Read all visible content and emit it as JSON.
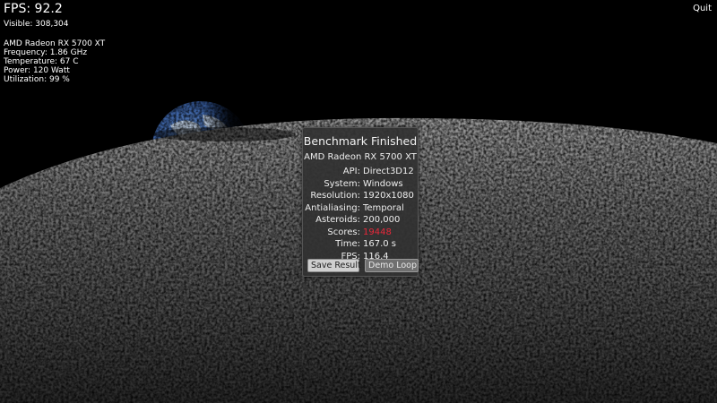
{
  "hud": {
    "fps": "FPS: 92.2",
    "visible": "Visible: 308,304",
    "gpu_name": "AMD Radeon RX 5700 XT",
    "frequency": "Frequency: 1.86 GHz",
    "temperature": "Temperature: 67 C",
    "power": "Power: 120 Watt",
    "utilization": "Utilization: 99 %"
  },
  "quit_label": "Quit",
  "dialog": {
    "title": "Benchmark Finished",
    "gpu": "AMD Radeon RX 5700 XT",
    "rows": [
      {
        "key": "API:",
        "value": "Direct3D12"
      },
      {
        "key": "System:",
        "value": "Windows"
      },
      {
        "key": "Resolution:",
        "value": "1920x1080"
      },
      {
        "key": "Antialiasing:",
        "value": "Temporal"
      },
      {
        "key": "Asteroids:",
        "value": "200,000"
      },
      {
        "key": "Scores:",
        "value": "19448"
      },
      {
        "key": "Time:",
        "value": "167.0 s"
      },
      {
        "key": "FPS:",
        "value": "116.4"
      }
    ],
    "save_label": "Save Result",
    "demo_label": "Demo Loop"
  },
  "colors": {
    "score": "#e8283a",
    "panel": "#323232",
    "background": "#000000"
  }
}
